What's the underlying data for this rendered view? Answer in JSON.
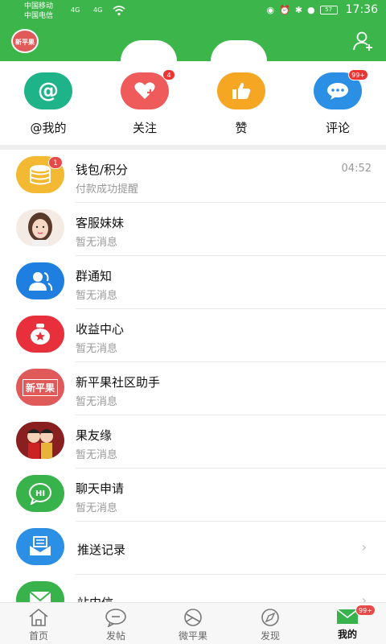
{
  "status_bar": {
    "carrier_1": "中国移动",
    "carrier_2": "中国电信",
    "net_1": "4G",
    "net_2": "4G",
    "time": "17:36",
    "battery": "57"
  },
  "header": {
    "logo_text": "新平果",
    "colors": {
      "bar": "#3cb54a"
    }
  },
  "quick_actions": [
    {
      "label": "@我的",
      "icon": "at-icon",
      "color": "#1fb38a",
      "badge": ""
    },
    {
      "label": "关注",
      "icon": "heart-plus-icon",
      "color": "#ef5b5b",
      "badge": "4"
    },
    {
      "label": "赞",
      "icon": "thumbs-up-icon",
      "color": "#f5a623",
      "badge": ""
    },
    {
      "label": "评论",
      "icon": "comment-icon",
      "color": "#2b8fe6",
      "badge": "99+"
    }
  ],
  "messages": [
    {
      "title": "钱包/积分",
      "subtitle": "付款成功提醒",
      "time": "04:52",
      "badge": "1",
      "icon": "wallet-coins-icon"
    },
    {
      "title": "客服妹妹",
      "subtitle": "暂无消息",
      "icon": "customer-service-avatar"
    },
    {
      "title": "群通知",
      "subtitle": "暂无消息",
      "icon": "group-icon"
    },
    {
      "title": "收益中心",
      "subtitle": "暂无消息",
      "icon": "income-bag-icon"
    },
    {
      "title": "新平果社区助手",
      "subtitle": "暂无消息",
      "icon": "community-logo-icon",
      "logo_text": "新平果"
    },
    {
      "title": "果友缘",
      "subtitle": "暂无消息",
      "icon": "couple-avatar"
    },
    {
      "title": "聊天申请",
      "subtitle": "暂无消息",
      "icon": "chat-hi-icon",
      "hi": "HI"
    }
  ],
  "links": [
    {
      "title": "推送记录",
      "icon": "push-record-icon"
    },
    {
      "title": "站内信",
      "icon": "mail-icon"
    }
  ],
  "tabbar": [
    {
      "label": "首页",
      "icon": "home-icon",
      "active": false
    },
    {
      "label": "发帖",
      "icon": "post-bubble-icon",
      "active": false
    },
    {
      "label": "微平果",
      "icon": "weipingguo-icon",
      "active": false
    },
    {
      "label": "发现",
      "icon": "compass-icon",
      "active": false
    },
    {
      "label": "我的",
      "icon": "mail-icon",
      "active": true,
      "badge": "99+"
    }
  ]
}
